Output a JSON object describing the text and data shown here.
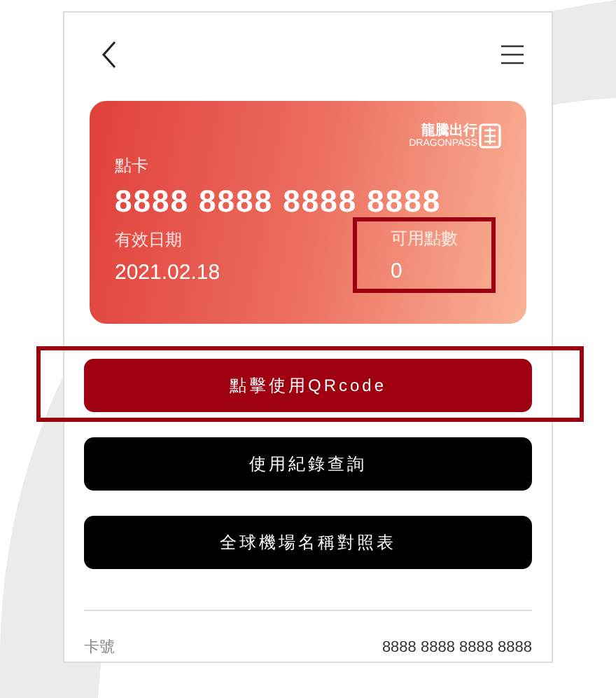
{
  "card": {
    "logo_text": "龍騰出行",
    "logo_subtext": "DRAGONPASS",
    "label": "點卡",
    "number": "8888 8888 8888 8888",
    "fields": [
      {
        "label": "有效日期",
        "value": "2021.02.18",
        "highlighted": false
      },
      {
        "label": "可用點數",
        "value": "0",
        "highlighted": true
      }
    ]
  },
  "buttons": [
    {
      "label": "點擊使用QRcode",
      "kind": "primary",
      "highlighted": true
    },
    {
      "label": "使用紀錄查詢",
      "kind": "dark",
      "highlighted": false
    },
    {
      "label": "全球機場名稱對照表",
      "kind": "dark",
      "highlighted": false
    }
  ],
  "info": [
    {
      "label": "卡號",
      "value": "8888 8888 8888 8888"
    }
  ]
}
